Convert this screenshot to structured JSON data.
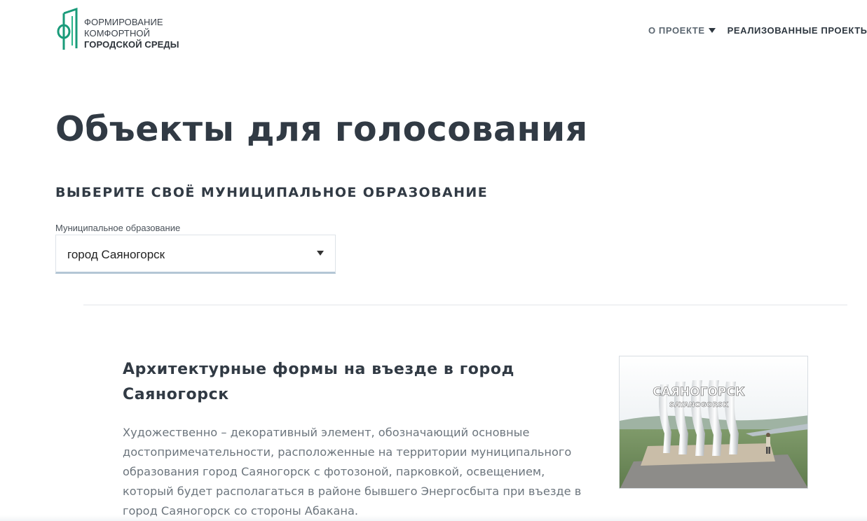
{
  "header": {
    "logo": {
      "line1": "ФОРМИРОВАНИЕ",
      "line2": "КОМФОРТНОЙ",
      "line3": "ГОРОДСКОЙ СРЕДЫ",
      "icon": "city-building-logo-icon",
      "accent_color": "#1a9b7a"
    },
    "nav": {
      "items": [
        {
          "label": "О ПРОЕКТЕ",
          "has_dropdown": true
        },
        {
          "label": "РЕАЛИЗОВАННЫЕ ПРОЕКТЫ",
          "has_dropdown": false
        }
      ]
    }
  },
  "main": {
    "title": "Объекты для голосования",
    "select_heading": "ВЫБЕРИТЕ СВОЁ МУНИЦИПАЛЬНОЕ ОБРАЗОВАНИЕ",
    "municipality_select": {
      "label": "Муниципальное образование",
      "value": "город Саяногорск"
    },
    "objects": [
      {
        "title": "Архитектурные формы на въезде в город Саяногорск",
        "description": "Художественно – декоративный элемент, обозначающий основные достопримечательности, расположенные на территории муниципального образования город Саяногорск с фотозоной, парковкой, освещением, который будет располагаться в районе бывшего Энергосбыта при въезде в город Саяногорск со стороны Абакана.",
        "image": {
          "sign_text": "САЯНОГОРСК",
          "sign_subtext": "SAYANOGORSK"
        }
      }
    ]
  }
}
